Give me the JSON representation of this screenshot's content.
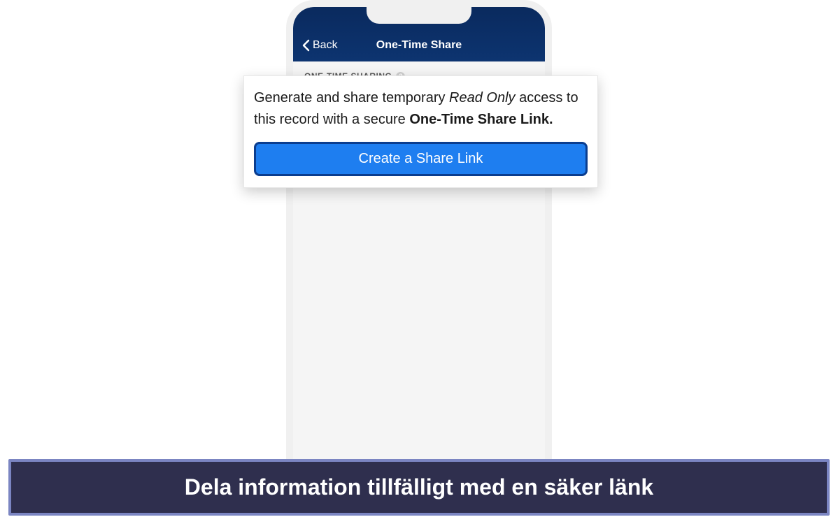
{
  "header": {
    "back_label": "Back",
    "title": "One-Time Share"
  },
  "section": {
    "label": "ONE-TIME SHARING",
    "help_glyph": "?"
  },
  "overlay": {
    "text_prefix": "Generate and share temporary ",
    "text_italic": "Read Only",
    "text_mid": " access to this record with a secure ",
    "text_bold": "One-Time Share Link.",
    "button_label": "Create a Share Link"
  },
  "caption": "Dela information tillfälligt med en säker länk"
}
